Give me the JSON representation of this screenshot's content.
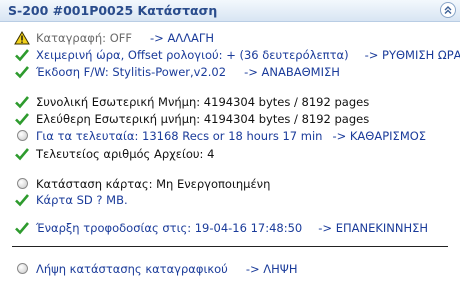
{
  "header": {
    "title": "S-200 #001P0025 Κατάσταση"
  },
  "rows": [
    {
      "label": "Καταγραφή: OFF",
      "action": "-> ΑΛΛΑΓΗ"
    },
    {
      "label": "Χειμερινή ώρα, Offset ρολογιού: + (36 δευτερόλεπτα)",
      "action": "-> ΡΥΘΜΙΣΗ ΩΡΑΣ"
    },
    {
      "label": "Έκδοση F/W: Stylitis-Power,v2.02",
      "action": "-> ΑΝΑΒΑΘΜΙΣΗ"
    },
    {
      "label": "Συνολική Εσωτερική Μνήμη: 4194304 bytes / 8192 pages"
    },
    {
      "label": "Ελεύθερη Εσωτερική μνήμη: 4194304 bytes / 8192 pages"
    },
    {
      "label": "Για τα τελευταία: 13168 Recs or 18 hours 17 min",
      "action": "-> ΚΑΘΑΡΙΣΜΟΣ"
    },
    {
      "label": "Τελευτείος αριθμός Αρχείου: 4"
    },
    {
      "label": "Κατάσταση κάρτας: Μη Ενεργοποιημένη"
    },
    {
      "label": "Κάρτα SD ? MB."
    },
    {
      "label": "Έναρξη τροφοδοσίας στις: 19-04-16 17:48:50",
      "action": "-> ΕΠΑΝΕΚΙΝΝΗΣΗ"
    },
    {
      "label": "Λήψη κατάστασης καταγραφικού",
      "action": "-> ΛΗΨΗ"
    }
  ],
  "icons": {
    "warning": "warning-icon",
    "ok": "checkmark-icon",
    "neutral": "status-circle-icon",
    "collapse": "double-chevron-up-icon"
  },
  "colors": {
    "title": "#2a4c8c",
    "text_blue": "#1a3b9a",
    "check_green": "#2e9b2e",
    "warning_yellow": "#f2d21c",
    "header_bg": "#dbe7f4"
  }
}
